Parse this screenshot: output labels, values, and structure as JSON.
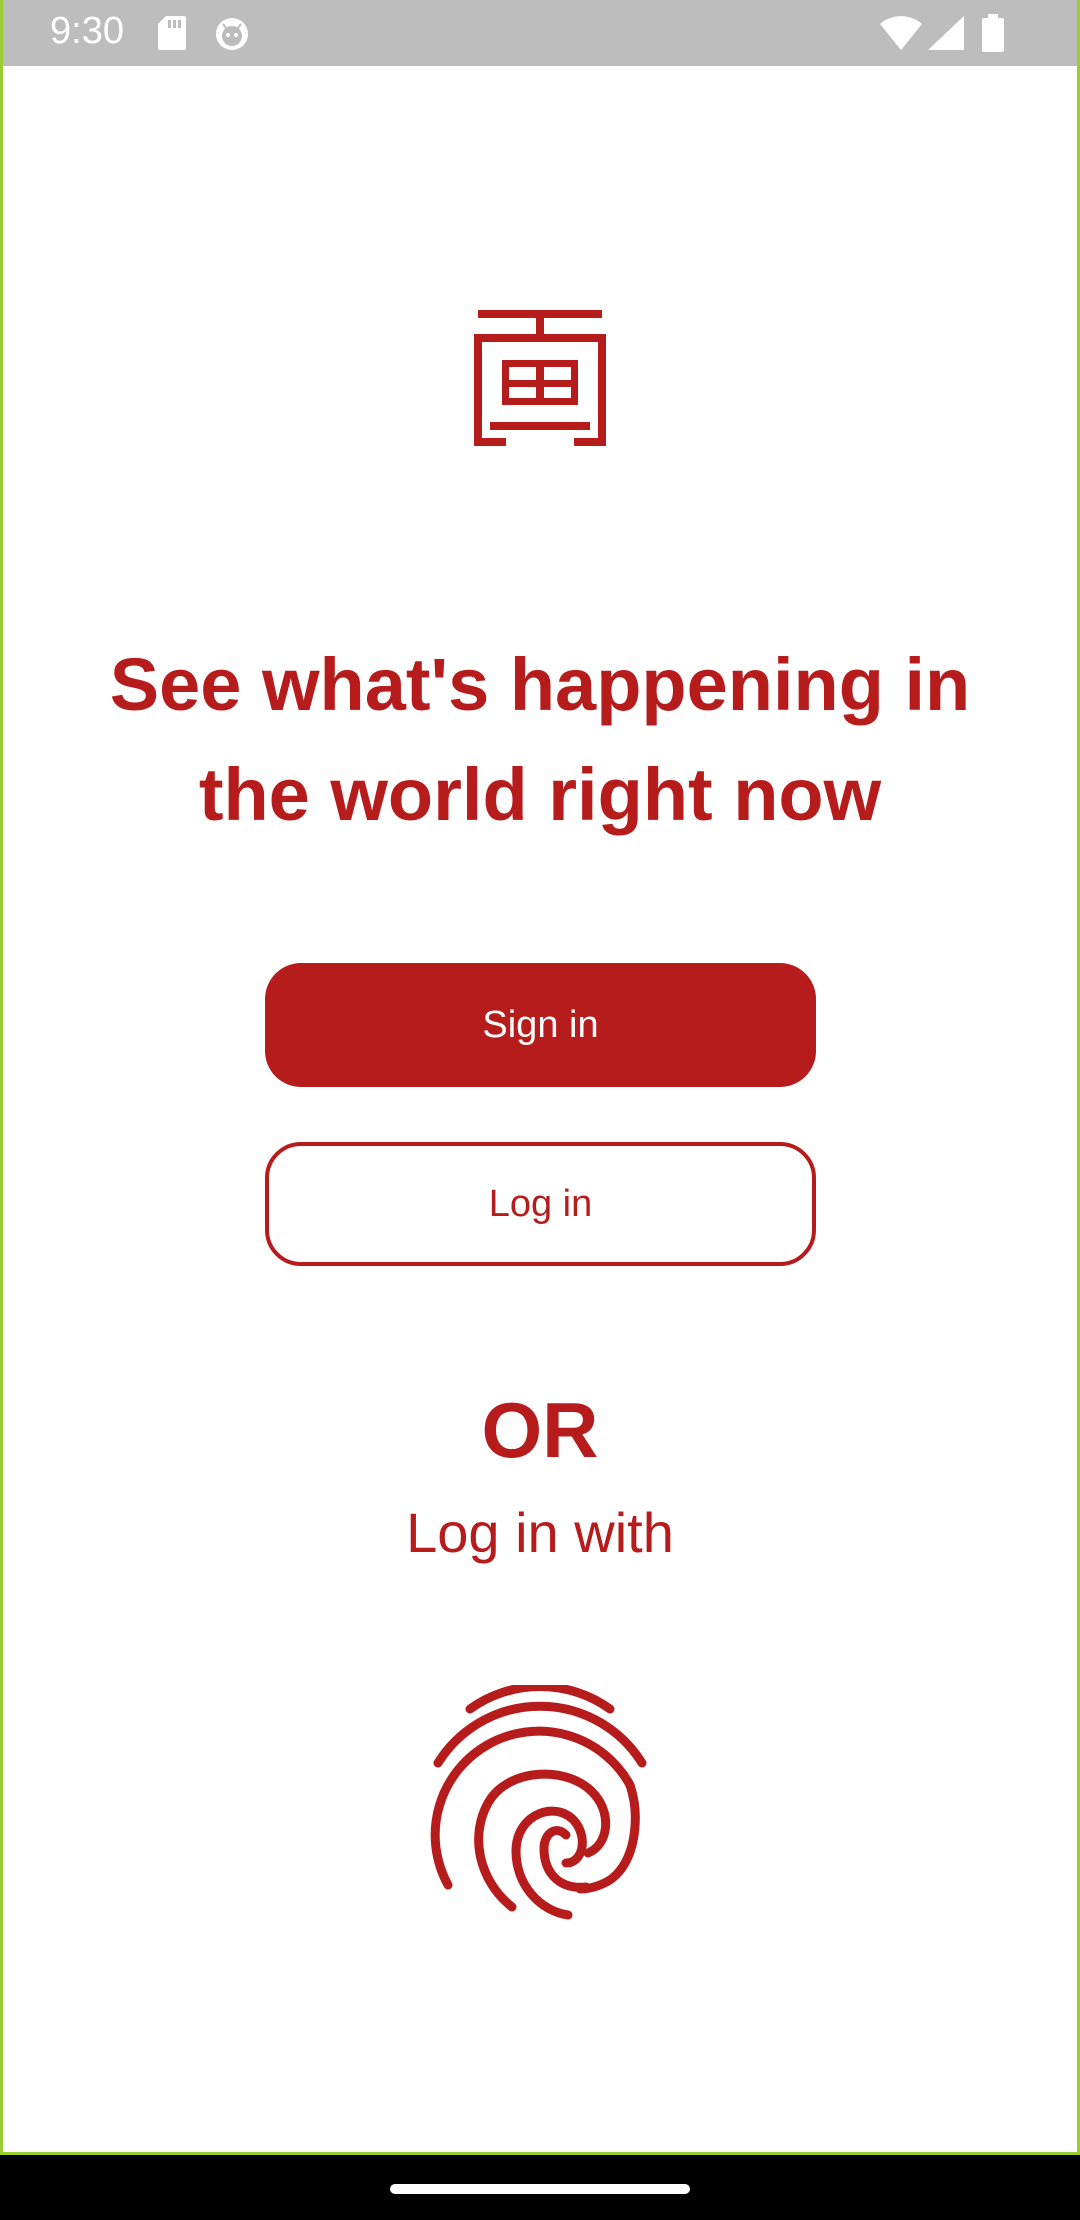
{
  "status_bar": {
    "time": "9:30",
    "icons": [
      "sd-card-icon",
      "android-face-icon",
      "wifi-icon",
      "cell-signal-icon",
      "battery-icon"
    ]
  },
  "logo": {
    "icon": "app-logo-icon"
  },
  "headline": "See what's happening in the world right now",
  "buttons": {
    "sign_in": "Sign in",
    "log_in": "Log in"
  },
  "or_label": "OR",
  "login_with_label": "Log in with",
  "fingerprint": {
    "icon": "fingerprint-icon"
  },
  "colors": {
    "accent": "#b71c1c",
    "status_bar": "#bdbdbd",
    "nav_bar": "#000000",
    "frame": "#9acd32"
  }
}
